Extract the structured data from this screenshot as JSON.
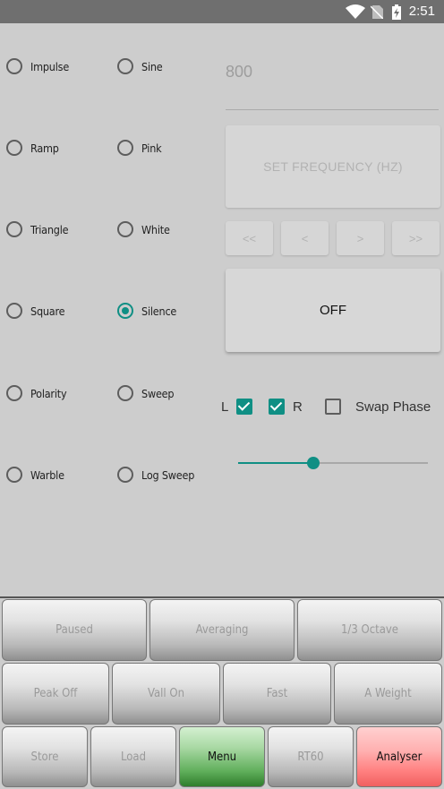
{
  "status_bar": {
    "time": "2:51"
  },
  "signals": {
    "left": [
      "Impulse",
      "Ramp",
      "Triangle",
      "Square",
      "Polarity",
      "Warble"
    ],
    "right": [
      "Sine",
      "Pink",
      "White",
      "Silence",
      "Sweep",
      "Log Sweep"
    ],
    "selected": "Silence"
  },
  "frequency": {
    "input_value": "800",
    "set_label": "SET FREQUENCY (HZ)",
    "nav": [
      "<<",
      "<",
      ">",
      ">>"
    ]
  },
  "power_button": "OFF",
  "channels": {
    "left_label": "L",
    "left_checked": true,
    "right_label": "R",
    "right_checked": true,
    "swap_label": "Swap Phase",
    "swap_checked": false
  },
  "slider": {
    "value": 0.4
  },
  "bottom": {
    "row1": [
      "Paused",
      "Averaging",
      "1/3 Octave"
    ],
    "row2": [
      "Peak Off",
      "Vall On",
      "Fast",
      "A Weight"
    ],
    "row3": [
      "Store",
      "Load",
      "Menu",
      "RT60",
      "Analyser"
    ]
  },
  "colors": {
    "accent": "#0f8f84",
    "menu_active": "#3f9a3b",
    "analyser_active": "#ff8a8a"
  }
}
